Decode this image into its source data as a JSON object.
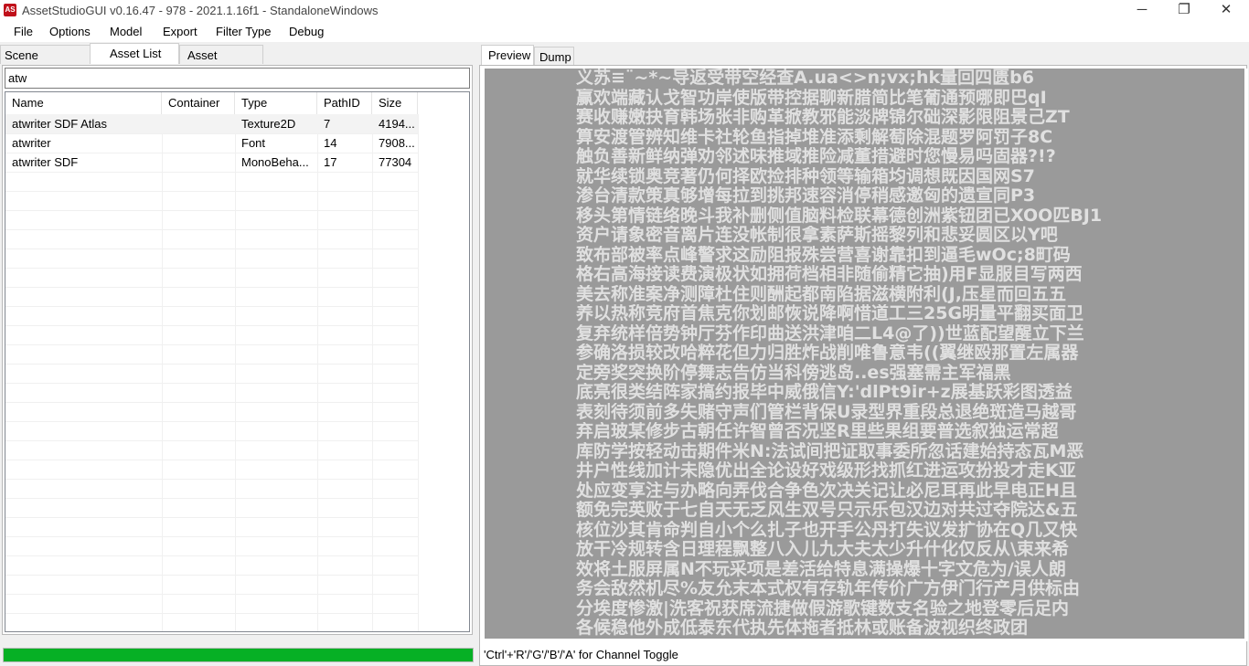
{
  "window": {
    "title": "AssetStudioGUI v0.16.47 - 978 - 2021.1.16f1 - StandaloneWindows",
    "icon_label": "AS",
    "controls": {
      "minimize": "─",
      "maximize": "❐",
      "close": "✕"
    }
  },
  "menu": {
    "items": [
      "File",
      "Options",
      "Model",
      "Export",
      "Filter Type",
      "Debug"
    ]
  },
  "left_tabs": [
    "Scene Hierarchy",
    "Asset List",
    "Asset Classes"
  ],
  "active_left_tab": "Asset List",
  "search": {
    "value": "atw"
  },
  "table": {
    "columns": [
      "Name",
      "Container",
      "Type",
      "PathID",
      "Size"
    ],
    "rows": [
      {
        "name": "atwriter SDF Atlas",
        "container": "",
        "type": "Texture2D",
        "path_id": "7",
        "size": "4194..."
      },
      {
        "name": "atwriter",
        "container": "",
        "type": "Font",
        "path_id": "14",
        "size": "7908..."
      },
      {
        "name": "atwriter SDF",
        "container": "",
        "type": "MonoBeha...",
        "path_id": "17",
        "size": "77304"
      }
    ]
  },
  "progress": {
    "value": 1.0,
    "color": "#06b025"
  },
  "right_tabs": [
    "Preview",
    "Dump"
  ],
  "active_right_tab": "Preview",
  "preview": {
    "background": "#9a9a9a",
    "glyph_rows": [
      "义苏≡¨~*~导返受带空经查A.ua<>n;vx;hk量回四匮b6",
      "赢欢端藏认戈智功岸使版带控据聊新腊简比笔葡通预哪即巴qI",
      "赛收赚嫩抉育韩场张非购革掀教邪能淡牌锦尔础深影限阻景己ZT",
      "算安渡管辨知维卡社轮鱼指掉堆准添剩解萄除混题罗阿罚子8C",
      "触负善新鲜纳弹劝邻述味推域推险减董措避时您慢易吗固器?!?",
      "就华续锁奥竞著仍何择欧捡排种领等输箱均调想既因国网S7",
      "渗台清款策真够增每拉到挑邦速容消停稍感邀匈的遗宣同P3",
      "移头第情链络晚斗我补删侧值脑料检联幕德创洲紫钮团已XOO匹BJ1",
      "资户请象密音离片连没帐制很拿素萨斯摇黎列和悲妥圆区以Y吧",
      "致布部被率点峰警求这励阻报殊尝营喜谢靠扣到逼毛wOc;8町码",
      "格右高海接读费演极状如拥荷档相非随偷精它抽)用F显服目写两西",
      "美去称准案净测障杜住则酬起都南陷据滋横附利(J,压星而回五五",
      "养以热称竞府首焦克你划邮恢说降啊惜道工三25G明量平翻买面卫",
      "复弃统样倍势钟厅芬作印曲送洪津咱二L4@了))世蓝配望醒立下兰",
      "参确洛损较改哈粹花但力归胜炸战削唯鲁意韦((翼继殴那置左属器",
      "定旁奖突换阶停舞志告仿当科傍逃岛..es强塞需主军福黑",
      "底亮很类结阵家搞约报毕中威俄信Y:'dlPt9ir+z展基跃彩图透益",
      "表刻待须前多失赌守声们管栏背保U录型界重段总退绝斑造马越哥",
      "弃启玻某修步古朝任许智曾否况坚R里些果组要普选叙独运常超",
      "库防学按轻动击期件米N:法试间把证取事委所忽话建始持态瓦M恶",
      "井户性线加计未隐优出全论设好戏级形找抓红进运攻扮投才走K亚",
      "处应变享注与办略向弄伐合争色次决关记让必尼耳再此早电正H且",
      "额免完英败于七自天无乏风生双号只示乐包汉边对共过夺院达&五",
      "核位沙其肯命判自小个么扎子也开手公丹打失议发扩协在Q几又快",
      "放干冷规转含日理程飘整八入儿九大夫太少升什化仅反从\\束来希",
      "效将土服屏属N不玩采项是差活给特息满操爆十字文危为/误人朗",
      "务会敌然机尽%友允末本式权有存轨年传价广方伊门行产月供标由",
      "分埃度惨激|洗客祝获席流捷做假游歌键数支名验之地登零后足内",
      "  各候稳他外成低泰东代执先体拖者抵林或账备波视织终政团"
    ]
  },
  "status": {
    "text": "'Ctrl'+'R'/'G'/'B'/'A' for Channel Toggle"
  }
}
